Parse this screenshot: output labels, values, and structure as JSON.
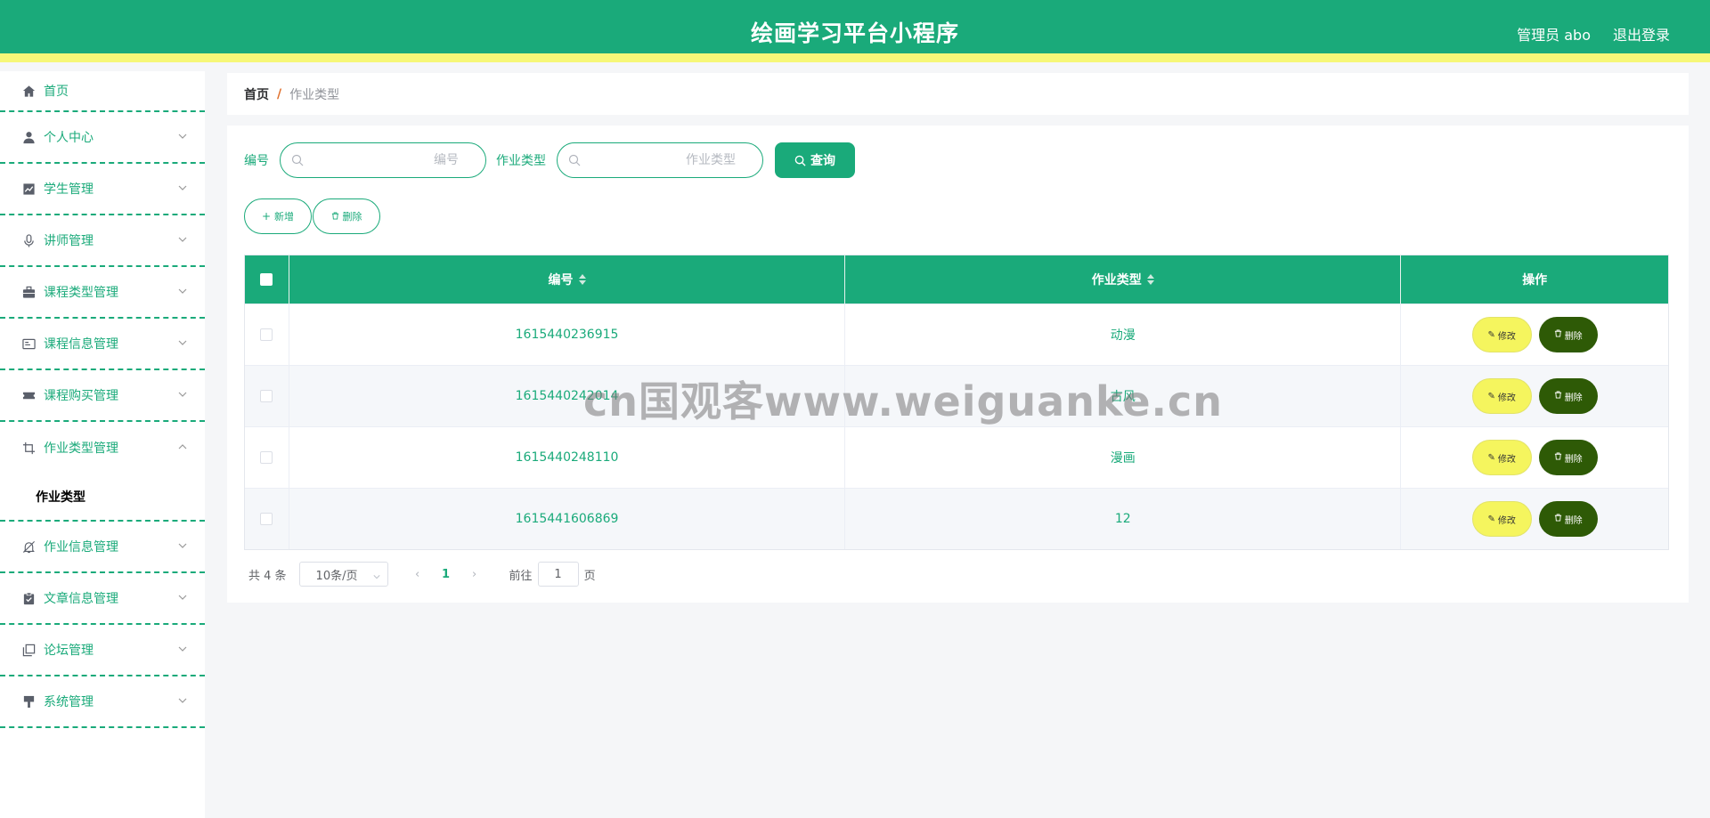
{
  "header": {
    "title": "绘画学习平台小程序",
    "admin": "管理员 abo",
    "logout": "退出登录"
  },
  "sidebar": {
    "items": [
      {
        "label": "首页",
        "icon": "home-icon"
      },
      {
        "label": "个人中心",
        "icon": "user-icon"
      },
      {
        "label": "学生管理",
        "icon": "chart-icon"
      },
      {
        "label": "讲师管理",
        "icon": "microphone-icon"
      },
      {
        "label": "课程类型管理",
        "icon": "briefcase-icon"
      },
      {
        "label": "课程信息管理",
        "icon": "id-card-icon"
      },
      {
        "label": "课程购买管理",
        "icon": "ticket-icon"
      },
      {
        "label": "作业类型管理",
        "icon": "crop-icon"
      },
      {
        "label": "作业信息管理",
        "icon": "bell-off-icon"
      },
      {
        "label": "文章信息管理",
        "icon": "clipboard-check-icon"
      },
      {
        "label": "论坛管理",
        "icon": "copy-icon"
      },
      {
        "label": "系统管理",
        "icon": "brush-icon"
      }
    ],
    "sub_item": "作业类型"
  },
  "breadcrumb": {
    "home": "首页",
    "sep": "/",
    "current": "作业类型"
  },
  "search": {
    "num_label": "编号",
    "num_placeholder": "编号",
    "type_label": "作业类型",
    "type_placeholder": "作业类型",
    "query_label": "查询"
  },
  "actions": {
    "add_label": "新增",
    "delete_label": "删除"
  },
  "table": {
    "headers": {
      "num": "编号",
      "type": "作业类型",
      "op": "操作"
    },
    "rows": [
      {
        "num": "1615440236915",
        "type": "动漫"
      },
      {
        "num": "1615440242014",
        "type": "古风"
      },
      {
        "num": "1615440248110",
        "type": "漫画"
      },
      {
        "num": "1615441606869",
        "type": "12"
      }
    ],
    "edit_label": "修改",
    "delete_label": "删除"
  },
  "pagination": {
    "total": "共 4 条",
    "page_size": "10条/页",
    "current_page": "1",
    "goto_prefix": "前往",
    "goto_value": "1",
    "goto_suffix": "页"
  },
  "watermark": "cn国观客www.weiguanke.cn",
  "colors": {
    "primary": "#1aaa7a",
    "stripe": "#f6f778",
    "edit": "#f5f55e",
    "delete": "#2e5a06"
  }
}
